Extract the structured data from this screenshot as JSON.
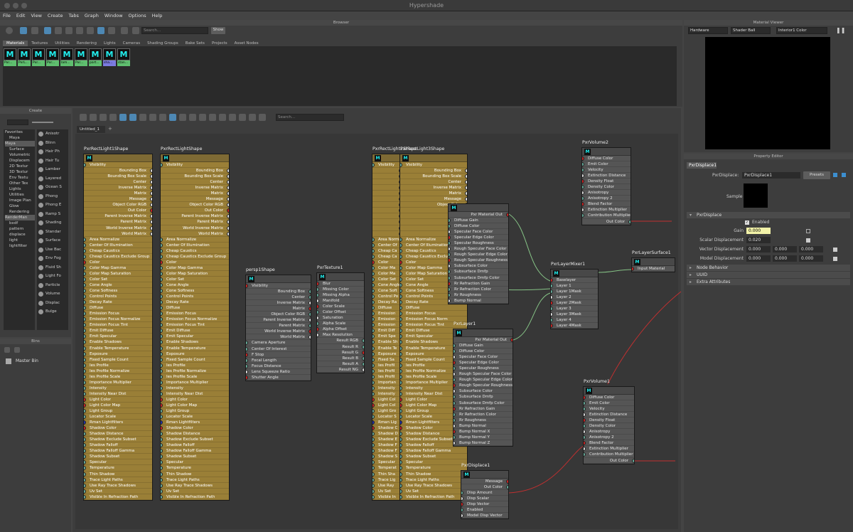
{
  "app": {
    "title": "Hypershade"
  },
  "menu": [
    "File",
    "Edit",
    "View",
    "Create",
    "Tabs",
    "Graph",
    "Window",
    "Options",
    "Help"
  ],
  "browser": {
    "title": "Browser",
    "search_placeholder": "Search...",
    "show_label": "Show",
    "tabs": [
      "Materials",
      "Textures",
      "Utilities",
      "Rendering",
      "Lights",
      "Cameras",
      "Shading Groups",
      "Bake Sets",
      "Projects",
      "Asset Nodes"
    ],
    "thumbs": [
      "Pxr...",
      "PxrL...",
      "Pxr...",
      "Pxr...",
      "lam...",
      "Pxr...",
      "part...",
      "sha...",
      "stan..."
    ]
  },
  "create": {
    "title": "Create",
    "tree": [
      "Favorites",
      "Maya",
      "Maya",
      "Surface",
      "Volumetric",
      "Displacem",
      "2D Textur",
      "3D Textur",
      "Env Textu",
      "Other Tex",
      "Lights",
      "Utilities",
      "Image Plan",
      "Glow",
      "Rendering",
      "RenderMan",
      "bxdf",
      "pattern",
      "displace",
      "light",
      "lightfilter"
    ],
    "shaders": [
      "Anisotr",
      "Blinn",
      "Hair Ph",
      "Hair Tu",
      "Lamber",
      "Layered",
      "Ocean S",
      "Phong",
      "Phong E",
      "Ramp S",
      "Shading",
      "Standar",
      "Surface",
      "Use Bac",
      "Env Fog",
      "Fluid Sh",
      "Light Fo",
      "Particle",
      "Volume",
      "Displac",
      "Bulge"
    ]
  },
  "bins": {
    "title": "Bins",
    "master": "Master Bin"
  },
  "graph": {
    "search_placeholder": "Search...",
    "tab": "Untitled_1"
  },
  "nodes": {
    "rl1": {
      "title": "PxrRectLight1Shape",
      "rows": [
        "Visibility",
        "Bounding Box",
        "Bounding Box Scale",
        "Center",
        "Inverse Matrix",
        "Matrix",
        "Message",
        "Object Color RGB",
        "Out Color",
        "Parent Inverse Matrix",
        "Parent Matrix",
        "World Inverse Matrix",
        "World Matrix",
        "Area Normalize",
        "Center Of Illumination",
        "Cheap Caustics",
        "Cheap Caustics Exclude Group",
        "Color",
        "Color Map Gamma",
        "Color Map Saturation",
        "Color Set",
        "Cone Angle",
        "Cone Softness",
        "Control Points",
        "Decay Rate",
        "Diffuse",
        "Emission Focus",
        "Emission Focus Normalize",
        "Emission Focus Tint",
        "Emit Diffuse",
        "Emit Specular",
        "Enable Shadows",
        "Enable Temperature",
        "Exposure",
        "Fixed Sample Count",
        "Ies Profile",
        "Ies Profile Normalize",
        "Ies Profile Scale",
        "Importance Multiplier",
        "Intensity",
        "Intensity Near Dist",
        "Light Color",
        "Light Color Map",
        "Light Group",
        "Locator Scale",
        "Rman Lightfilters",
        "Shadow Color",
        "Shadow Distance",
        "Shadow Exclude Subset",
        "Shadow Falloff",
        "Shadow Falloff Gamma",
        "Shadow Subset",
        "Specular",
        "Temperature",
        "Thin Shadow",
        "Trace Light Paths",
        "Use Ray Trace Shadows",
        "Uv Set",
        "Visible In Refraction Path"
      ]
    },
    "rl2": {
      "title": "PxrRectLightShape",
      "rows": [
        "Visibility",
        "Bounding Box",
        "Bounding Box Scale",
        "Center",
        "Inverse Matrix",
        "Matrix",
        "Message",
        "Object Color RGB",
        "Out Color",
        "Parent Inverse Matrix",
        "Parent Matrix",
        "World Inverse Matrix",
        "World Matrix",
        "Area Normalize",
        "Center Of Illumination",
        "Cheap Caustics",
        "Cheap Caustics Exclude Group",
        "Color",
        "Color Map Gamma",
        "Color Map Saturation",
        "Color Set",
        "Cone Angle",
        "Cone Softness",
        "Control Points",
        "Decay Rate",
        "Diffuse",
        "Emission Focus",
        "Emission Focus Normalize",
        "Emission Focus Tint",
        "Emit Diffuse",
        "Emit Specular",
        "Enable Shadows",
        "Enable Temperature",
        "Exposure",
        "Fixed Sample Count",
        "Ies Profile",
        "Ies Profile Normalize",
        "Ies Profile Scale",
        "Importance Multiplier",
        "Intensity",
        "Intensity Near Dist",
        "Light Color",
        "Light Color Map",
        "Light Group",
        "Locator Scale",
        "Rman Lightfilters",
        "Shadow Color",
        "Shadow Distance",
        "Shadow Exclude Subset",
        "Shadow Falloff",
        "Shadow Falloff Gamma",
        "Shadow Subset",
        "Specular",
        "Temperature",
        "Thin Shadow",
        "Trace Light Paths",
        "Use Ray Trace Shadows",
        "Uv Set",
        "Visible In Refraction Path"
      ]
    },
    "rl3": {
      "title": "PxrRectLight2Shape",
      "rows": [
        "Visibility",
        "",
        "",
        "",
        "",
        "",
        "",
        "",
        "",
        "",
        "",
        "",
        "",
        "Area Normalize",
        "Center Of",
        "Cheap Ca",
        "Cheap Ca",
        "Color",
        "Color Ma",
        "Color Ma",
        "Color Set",
        "Cone Angle",
        "Cone Soft",
        "Control Po",
        "Decay Ra",
        "Diffuse",
        "Emission",
        "Emission",
        "Emission",
        "Emit Diff",
        "Emit Spe",
        "Enable Sh",
        "Enable Te",
        "Exposure",
        "Fixed Sa",
        "Ies Profil",
        "Ies Profil",
        "Ies Profil",
        "Importan",
        "Intensity",
        "Intensity",
        "Light Col",
        "Light Col",
        "Light Gro",
        "Locator S",
        "Rman Lig",
        "Shadow C",
        "Shadow D",
        "Shadow E",
        "Shadow F",
        "Shadow F",
        "Shadow S",
        "Specular",
        "Temperat",
        "Thin Sha",
        "Trace Lig",
        "Use Ray",
        "Uv Set",
        "Visible In"
      ]
    },
    "rl4": {
      "title": "PxrRectLight3Shape",
      "rows": [
        "Visibility",
        "Bounding Box",
        "Bounding Box Scale",
        "Center",
        "Inverse Matrix",
        "Matrix",
        "Message",
        "Object Color",
        "",
        "",
        "",
        "",
        "",
        "Area Normalize",
        "Center Of Illumination",
        "Cheap Caustics",
        "Cheap Caustics Exclude",
        "Color",
        "Color Map Gamma",
        "Color Map Saturation",
        "Color Set",
        "Cone Angle",
        "Cone Softness",
        "Control Points",
        "Decay Rate",
        "Diffuse",
        "Emission Focus",
        "Emission Focus Norm",
        "Emission Focus Tint",
        "Emit Diffuse",
        "Emit Specular",
        "Enable Shadows",
        "Enable Temperature",
        "Exposure",
        "Fixed Sample Count",
        "Ies Profile",
        "Ies Profile Normalize",
        "Ies Profile Scale",
        "Importance Multiplier",
        "Intensity",
        "Intensity Near Dist",
        "Light Color",
        "Light Color Map",
        "Light Group",
        "Locator Scale",
        "Rman Lightfilters",
        "Shadow Color",
        "Shadow Distance",
        "Shadow Exclude Subset",
        "Shadow Falloff",
        "Shadow Falloff Gamma",
        "Shadow Subset",
        "Specular",
        "Temperature",
        "Thin Shadow",
        "Trace Light Paths",
        "Use Ray Trace Shadows",
        "Uv Set",
        "Visible In Refraction Path"
      ]
    },
    "persp": {
      "title": "persp1Shape",
      "rows": [
        "Visibility",
        "Bounding Box",
        "Center",
        "Inverse Matrix",
        "Matrix",
        "Object Color RGB",
        "Parent Inverse Matrix",
        "Parent Matrix",
        "World Inverse Matrix",
        "World Matrix",
        "Camera Aperture",
        "Center Of Interest",
        "F Stop",
        "Focal Length",
        "Focus Distance",
        "Lens Squeeze Ratio",
        "Shutter Angle"
      ]
    },
    "tex": {
      "title": "PxrTexture1",
      "rows": [
        "Blur",
        "Missing Color",
        "Missing Alpha",
        "Manifold",
        "Color Scale",
        "Color Offset",
        "Saturation",
        "Alpha Scale",
        "Alpha Offset",
        "Max Resolution",
        "Result RGB",
        "Result R",
        "Result G",
        "Result B",
        "Result A",
        "Result NG"
      ]
    },
    "pl0": {
      "title": "",
      "rows": [
        "Pxr Material Out",
        "Diffuse Gain",
        "Diffuse Color",
        "Specular Face Color",
        "Specular Edge Color",
        "Specular Roughness",
        "Rough Specular Face Color",
        "Rough Specular Edge Color",
        "Rough Specular Roughness",
        "Subsurface Color",
        "Subsurface Dmfp",
        "Subsurface Dmfp Color",
        "Rr Refraction Gain",
        "Rr Refraction Color",
        "Rr Roughness",
        "Bump Normal"
      ]
    },
    "pl1": {
      "title": "PxrLayer1",
      "rows": [
        "Pxr Material Out",
        "Diffuse Gain",
        "Diffuse Color",
        "Specular Face Color",
        "Specular Edge Color",
        "Specular Roughness",
        "Rough Specular Face Color",
        "Rough Specular Edge Color",
        "Rough Specular Roughness",
        "Subsurface Color",
        "Subsurface Dmfp",
        "Subsurface Dmfp Color",
        "Rr Refraction Gain",
        "Rr Refraction Color",
        "Rr Roughness",
        "Bump Normal",
        "Bump Normal X",
        "Bump Normal Y",
        "Bump Normal Z"
      ]
    },
    "mixer": {
      "title": "PxrLayerMixer1",
      "rows": [
        "Baselayer",
        "Layer 1",
        "Layer 1Mask",
        "Layer 2",
        "Layer 2Mask",
        "Layer 3",
        "Layer 3Mask",
        "Layer 4",
        "Layer 4Mask"
      ]
    },
    "vol2": {
      "title": "PxrVolume2",
      "rows": [
        "Diffuse Color",
        "Emit Color",
        "Velocity",
        "Extinction Distance",
        "Density Float",
        "Density Color",
        "Anisotropy",
        "Anisotropy 2",
        "Blend Factor",
        "Extinction Multiplier",
        "Contribution Multiplier",
        "Out Color"
      ]
    },
    "vol1": {
      "title": "PxrVolume1",
      "rows": [
        "Diffuse Color",
        "Emit Color",
        "Velocity",
        "Extinction Distance",
        "Density Float",
        "Density Color",
        "Anisotropy",
        "Anisotropy 2",
        "Blend Factor",
        "Extinction Multiplier",
        "Contribution Multiplier",
        "Out Color"
      ]
    },
    "surf": {
      "title": "PxrLayerSurface1",
      "rows": [
        "Input Material"
      ]
    },
    "disp": {
      "title": "PxrDisplace1",
      "rows": [
        "Message",
        "Out Color",
        "Disp Amount",
        "Disp Scalar",
        "Disp Vector",
        "Enabled",
        "Model Disp Vector"
      ]
    }
  },
  "viewer": {
    "title": "Material Viewer",
    "renderer": "Hardware",
    "shape": "Shader Ball",
    "material": "Interior1 Color"
  },
  "prop": {
    "title": "Property Editor",
    "tab": "PxrDisplace1",
    "type_label": "PxrDisplace:",
    "name": "PxrDisplace1",
    "presets": "Presets",
    "sample": "Sample",
    "section": "PxrDisplace",
    "enabled": "Enabled",
    "fields": [
      {
        "label": "Gain",
        "value": "0.000"
      },
      {
        "label": "Scalar Displacement",
        "value": "0.020"
      },
      {
        "label": "Vector Displacement",
        "value": "0.000",
        "v2": "0.000",
        "v3": "0.000"
      },
      {
        "label": "Model Displacement",
        "value": "0.000",
        "v2": "0.000",
        "v3": "0.000"
      }
    ],
    "sections": [
      "Node Behavior",
      "UUID",
      "Extra Attributes"
    ]
  }
}
